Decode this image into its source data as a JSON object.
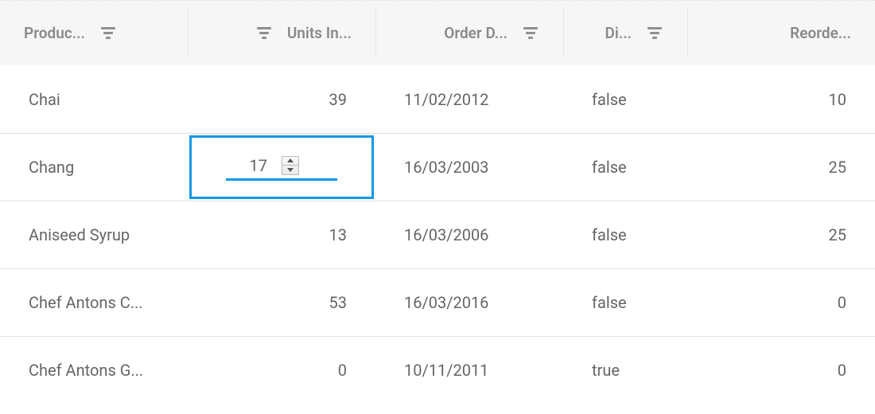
{
  "columns": {
    "product": {
      "label": "Produc..."
    },
    "units": {
      "label": "Units In..."
    },
    "date": {
      "label": "Order D..."
    },
    "disc": {
      "label": "Di..."
    },
    "reorder": {
      "label": "Reorde..."
    }
  },
  "rows": [
    {
      "product": "Chai",
      "units": "39",
      "date": "11/02/2012",
      "disc": "false",
      "reorder": "10"
    },
    {
      "product": "Chang",
      "units": "17",
      "date": "16/03/2003",
      "disc": "false",
      "reorder": "25"
    },
    {
      "product": "Aniseed Syrup",
      "units": "13",
      "date": "16/03/2006",
      "disc": "false",
      "reorder": "25"
    },
    {
      "product": "Chef Antons C...",
      "units": "53",
      "date": "16/03/2016",
      "disc": "false",
      "reorder": "0"
    },
    {
      "product": "Chef Antons G...",
      "units": "0",
      "date": "10/11/2011",
      "disc": "true",
      "reorder": "0"
    }
  ],
  "editing": {
    "row": 1,
    "col": "units",
    "value": "17"
  },
  "colors": {
    "focus": "#0e98e6"
  }
}
